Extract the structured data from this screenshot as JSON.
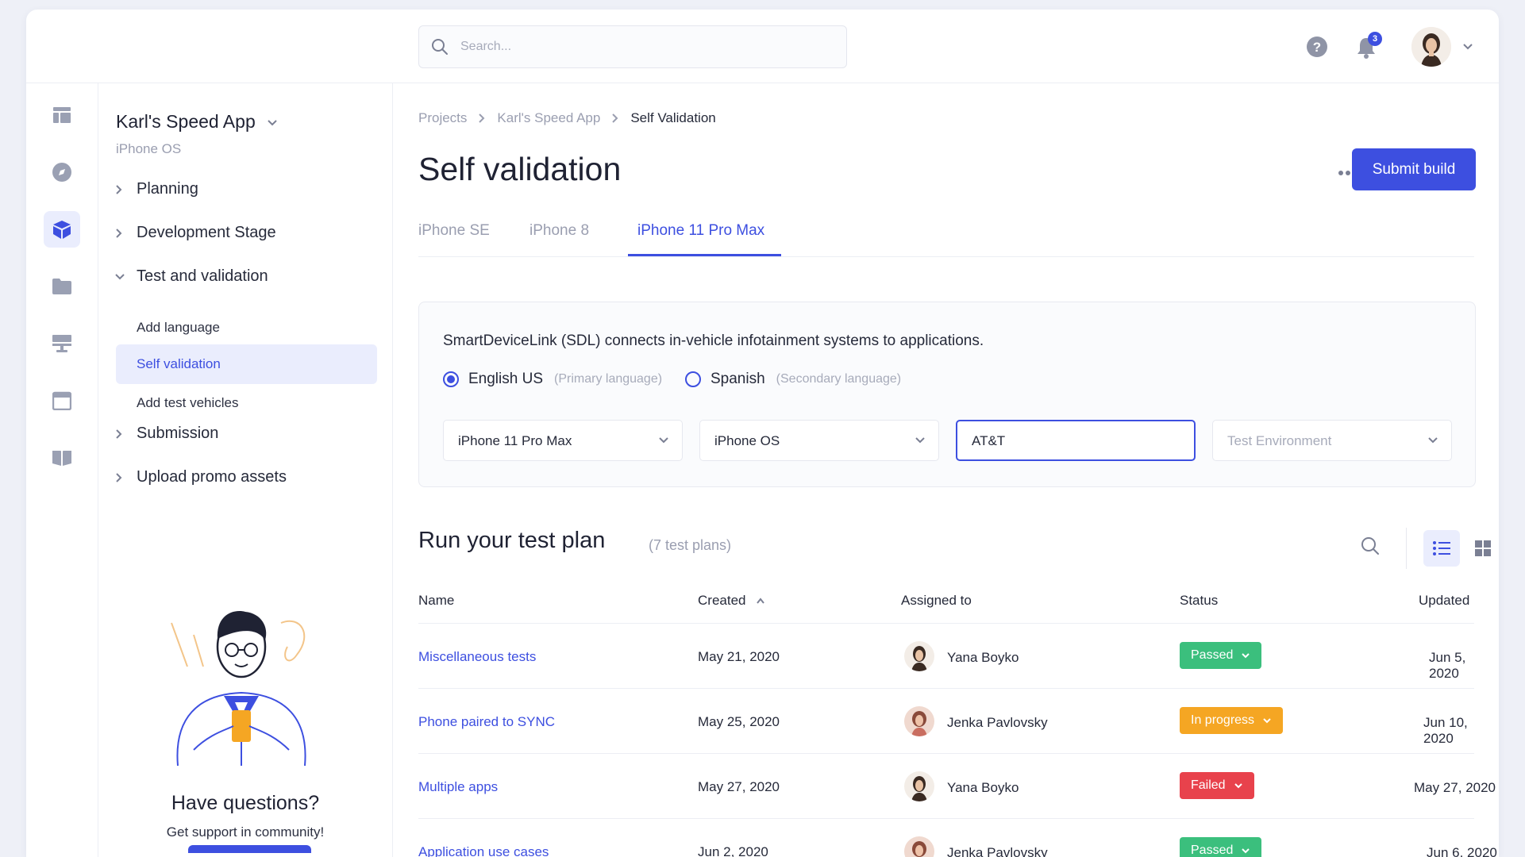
{
  "topbar": {
    "search_placeholder": "Search...",
    "notification_count": "3",
    "icons": [
      "search-icon",
      "help-icon",
      "bell-icon",
      "chevron-down-icon"
    ]
  },
  "rail": {
    "icons": [
      "dashboard-icon",
      "compass-icon",
      "cube-icon",
      "folder-icon",
      "monitor-icon",
      "calendar-icon",
      "book-icon"
    ],
    "active_index": 2
  },
  "project": {
    "name": "Karl's Speed App",
    "platform": "iPhone OS"
  },
  "nav": {
    "planning": "Planning",
    "development": "Development Stage",
    "test": "Test and validation",
    "add_language": "Add language",
    "self_validation": "Self validation",
    "add_test_vehicles": "Add test vehicles",
    "submission": "Submission",
    "upload_promo": "Upload promo assets"
  },
  "help": {
    "title": "Have questions?",
    "subtitle": "Get support in community!"
  },
  "breadcrumb": {
    "projects": "Projects",
    "app": "Karl's Speed App",
    "current": "Self Validation"
  },
  "page": {
    "title": "Self validation",
    "submit_label": "Submit build"
  },
  "tabs": [
    {
      "label": "iPhone SE",
      "active": false
    },
    {
      "label": "iPhone 8",
      "active": false
    },
    {
      "label": "iPhone 11 Pro Max",
      "active": true
    }
  ],
  "config": {
    "description": "SmartDeviceLink (SDL) connects in-vehicle infotainment systems to applications.",
    "lang_primary": "English US",
    "lang_primary_hint": "(Primary language)",
    "lang_secondary": "Spanish",
    "lang_secondary_hint": "(Secondary language)",
    "device": "iPhone 11 Pro Max",
    "os": "iPhone OS",
    "carrier": "AT&T",
    "environment_placeholder": "Test Environment"
  },
  "testplan": {
    "title": "Run your test plan",
    "count": "(7 test plans)",
    "columns": {
      "name": "Name",
      "created": "Created",
      "assigned": "Assigned to",
      "status": "Status",
      "updated": "Updated"
    },
    "rows": [
      {
        "name": "Miscellaneous tests",
        "created": "May 21, 2020",
        "assignee": "Yana Boyko",
        "status": "Passed",
        "updated": "Jun 5, 2020"
      },
      {
        "name": "Phone paired to SYNC",
        "created": "May 25, 2020",
        "assignee": "Jenka Pavlovsky",
        "status": "In progress",
        "updated": "Jun 10, 2020"
      },
      {
        "name": "Multiple apps",
        "created": "May 27, 2020",
        "assignee": "Yana Boyko",
        "status": "Failed",
        "updated": "May 27, 2020"
      },
      {
        "name": "Application use cases",
        "created": "Jun 2, 2020",
        "assignee": "Jenka Pavlovsky",
        "status": "Passed",
        "updated": "Jun 6, 2020"
      }
    ]
  },
  "colors": {
    "accent": "#3d4fe0",
    "passed": "#3bbf7d",
    "in_progress": "#f5a623",
    "failed": "#e8424c"
  }
}
